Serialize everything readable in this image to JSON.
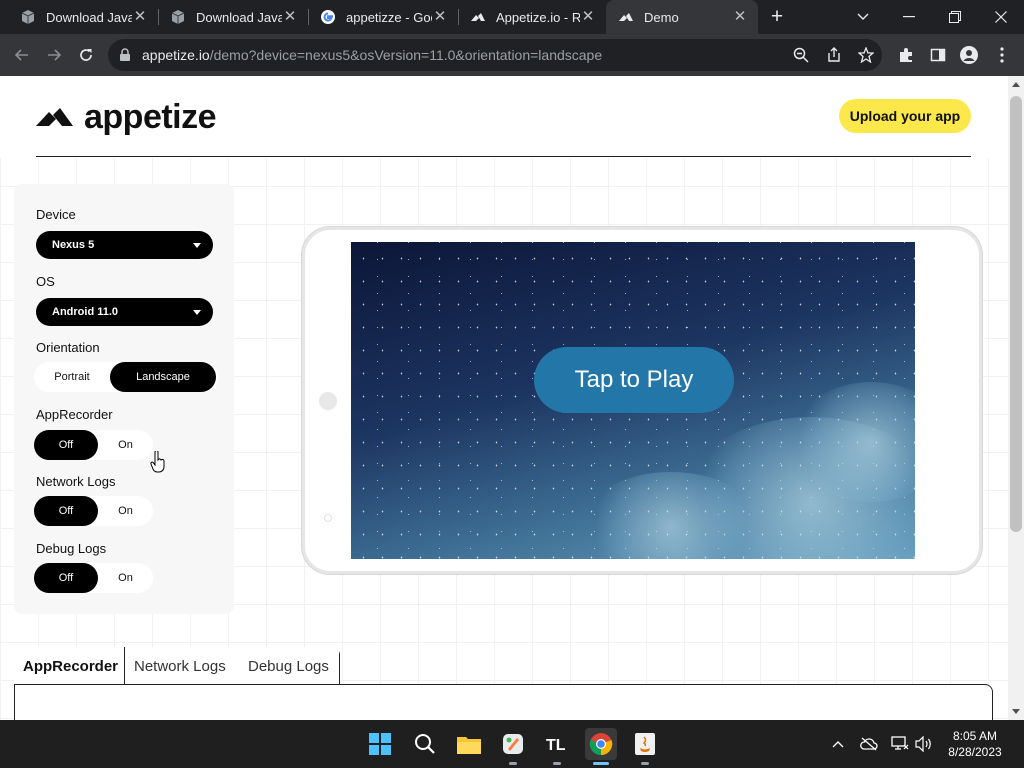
{
  "browser": {
    "tabs": [
      {
        "title": "Download Java f",
        "icon": "box-icon",
        "active": false
      },
      {
        "title": "Download Java f",
        "icon": "box-icon",
        "active": false
      },
      {
        "title": "appetizze - Goo",
        "icon": "google-icon",
        "active": false
      },
      {
        "title": "Appetize.io - Ru",
        "icon": "appetize-icon",
        "active": false
      },
      {
        "title": "Demo",
        "icon": "appetize-icon",
        "active": true
      }
    ],
    "url_host": "appetize.io",
    "url_path": "/demo?device=nexus5&osVersion=11.0&orientation=landscape"
  },
  "page": {
    "logo_text": "appetize",
    "upload_label": "Upload your app",
    "settings": {
      "device_label": "Device",
      "device_value": "Nexus 5",
      "os_label": "OS",
      "os_value": "Android 11.0",
      "orientation_label": "Orientation",
      "orientation_options": [
        "Portrait",
        "Landscape"
      ],
      "orientation_selected": "Landscape",
      "apprecorder_label": "AppRecorder",
      "network_logs_label": "Network Logs",
      "debug_logs_label": "Debug Logs",
      "toggle_off": "Off",
      "toggle_on": "On"
    },
    "emulator": {
      "play_label": "Tap to Play"
    },
    "log_tabs": [
      "AppRecorder",
      "Network Logs",
      "Debug Logs"
    ]
  },
  "taskbar": {
    "time": "8:05 AM",
    "date": "8/28/2023",
    "apps": [
      "windows-start-icon",
      "search-icon",
      "file-explorer-icon",
      "app-icon",
      "tl-icon",
      "chrome-icon",
      "java-icon"
    ]
  },
  "colors": {
    "accent_yellow": "#fde84c",
    "toggle_black": "#000000",
    "play_blue": "#2377a8",
    "browser_dark": "#202124"
  }
}
